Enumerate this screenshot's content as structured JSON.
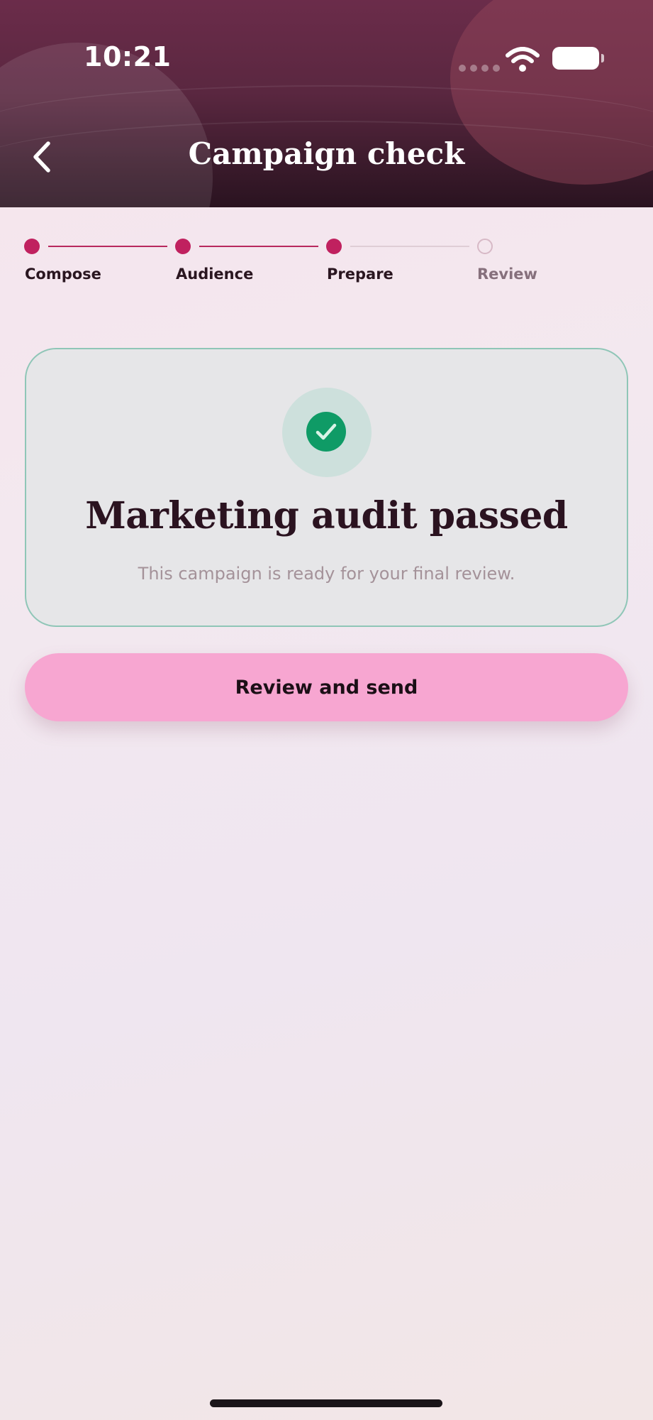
{
  "status_bar": {
    "time": "10:21"
  },
  "header": {
    "title": "Campaign check"
  },
  "stepper": {
    "steps": [
      {
        "label": "Compose",
        "state": "done"
      },
      {
        "label": "Audience",
        "state": "done"
      },
      {
        "label": "Prepare",
        "state": "current"
      },
      {
        "label": "Review",
        "state": "todo"
      }
    ]
  },
  "audit_card": {
    "title": "Marketing audit passed",
    "subtitle": "This campaign is ready for your final review.",
    "icon": "check-circle-icon"
  },
  "actions": {
    "primary_label": "Review and send"
  },
  "colors": {
    "accent": "#c0215f",
    "success": "#0f9b66",
    "button": "#f7a6d1",
    "header_dark": "#2a1320"
  }
}
